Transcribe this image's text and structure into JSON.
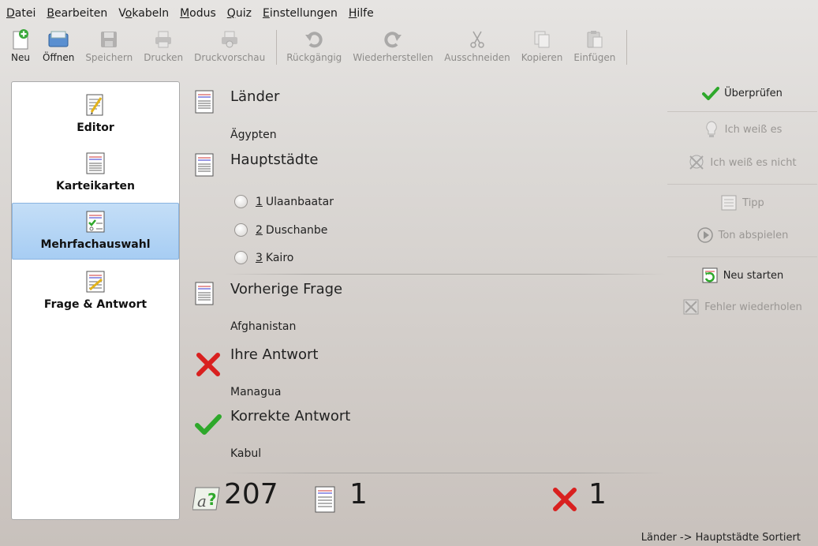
{
  "menu": {
    "items": [
      {
        "label": "Datei",
        "accel": "D",
        "rest": "atei"
      },
      {
        "label": "Bearbeiten",
        "accel": "B",
        "rest": "earbeiten"
      },
      {
        "label": "Vokabeln",
        "pre": "V",
        "accel": "o",
        "rest": "kabeln"
      },
      {
        "label": "Modus",
        "accel": "M",
        "rest": "odus"
      },
      {
        "label": "Quiz",
        "accel": "Q",
        "rest": "uiz"
      },
      {
        "label": "Einstellungen",
        "accel": "E",
        "rest": "instellungen"
      },
      {
        "label": "Hilfe",
        "accel": "H",
        "rest": "ilfe"
      }
    ]
  },
  "toolbar": {
    "new": "Neu",
    "open": "Öffnen",
    "save": "Speichern",
    "print": "Drucken",
    "print_preview": "Druckvorschau",
    "undo": "Rückgängig",
    "redo": "Wiederherstellen",
    "cut": "Ausschneiden",
    "copy": "Kopieren",
    "paste": "Einfügen"
  },
  "sidebar": {
    "items": [
      {
        "label": "Editor",
        "icon": "editor-icon"
      },
      {
        "label": "Karteikarten",
        "icon": "flashcards-icon"
      },
      {
        "label": "Mehrfachauswahl",
        "icon": "multiple-choice-icon"
      },
      {
        "label": "Frage & Antwort",
        "icon": "question-answer-icon"
      }
    ],
    "active_index": 2
  },
  "quiz": {
    "question_header": "Länder",
    "question": "Ägypten",
    "answer_header": "Hauptstädte",
    "choices": [
      {
        "num": "1",
        "text": "Ulaanbaatar"
      },
      {
        "num": "2",
        "text": "Duschanbe"
      },
      {
        "num": "3",
        "text": "Kairo"
      }
    ],
    "previous_header": "Vorherige Frage",
    "previous_value": "Afghanistan",
    "your_answer_header": "Ihre Antwort",
    "your_answer_value": "Managua",
    "correct_answer_header": "Korrekte Antwort",
    "correct_answer_value": "Kabul"
  },
  "stats": {
    "remaining": "207",
    "answered": "1",
    "errors": "1"
  },
  "right_panel": {
    "check": "Überprüfen",
    "know": "Ich weiß es",
    "dont_know": "Ich weiß es nicht",
    "hint": "Tipp",
    "play_sound": "Ton abspielen",
    "restart": "Neu starten",
    "repeat_errors": "Fehler wiederholen"
  },
  "status": {
    "text": "Länder -> Hauptstädte Sortiert"
  },
  "colors": {
    "correct_green": "#2ea82b",
    "wrong_red": "#d9201f",
    "active_blue": "#a7cdf3"
  }
}
